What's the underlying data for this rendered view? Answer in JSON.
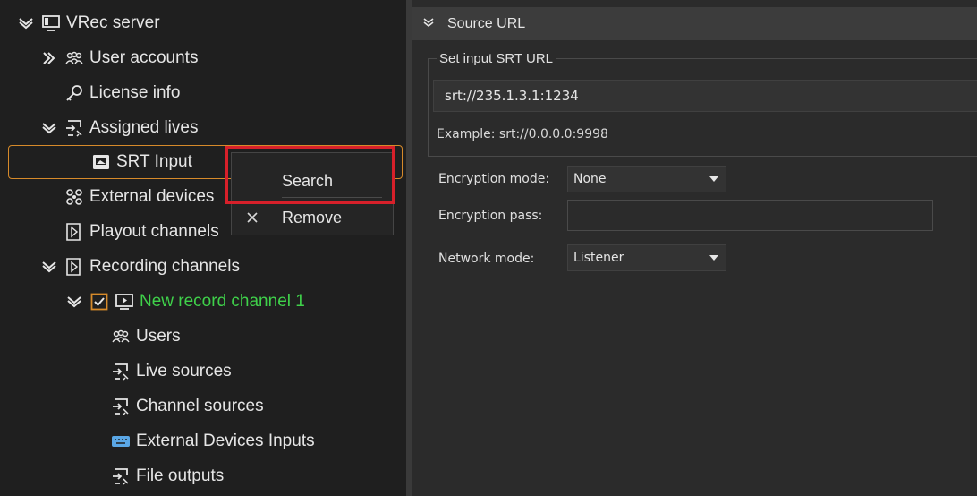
{
  "tree": {
    "items": [
      {
        "label": "VRec server",
        "icon": "monitor-icon"
      },
      {
        "label": "User accounts",
        "icon": "users-icon"
      },
      {
        "label": "License info",
        "icon": "key-icon"
      },
      {
        "label": "Assigned lives",
        "icon": "live-source-icon"
      },
      {
        "label": "SRT Input",
        "icon": "input-icon"
      },
      {
        "label": "External devices",
        "icon": "devices-icon"
      },
      {
        "label": "Playout channels",
        "icon": "playout-icon"
      },
      {
        "label": "Recording channels",
        "icon": "recording-icon"
      },
      {
        "label": "New record channel 1",
        "icon": "channel-icon"
      },
      {
        "label": "Users",
        "icon": "users-icon"
      },
      {
        "label": "Live sources",
        "icon": "live-source-icon"
      },
      {
        "label": "Channel sources",
        "icon": "live-source-icon"
      },
      {
        "label": "External Devices Inputs",
        "icon": "keyboard-icon"
      },
      {
        "label": "File outputs",
        "icon": "live-source-icon"
      }
    ]
  },
  "context_menu": {
    "items": [
      {
        "label": "Search",
        "icon": ""
      },
      {
        "label": "Remove",
        "icon": "close-icon"
      }
    ]
  },
  "panel": {
    "header_title": "Source URL",
    "group_title": "Set input SRT URL",
    "url_value": "srt://235.1.3.1:1234",
    "example": "Example: srt://0.0.0.0:9998",
    "encryption_mode_label": "Encryption mode:",
    "encryption_mode_value": "None",
    "encryption_pass_label": "Encryption pass:",
    "encryption_pass_value": "",
    "network_mode_label": "Network mode:",
    "network_mode_value": "Listener"
  },
  "colors": {
    "accent_selected": "#d68a2a",
    "highlight_box": "#d7202a",
    "active_channel": "#3fd14a"
  }
}
